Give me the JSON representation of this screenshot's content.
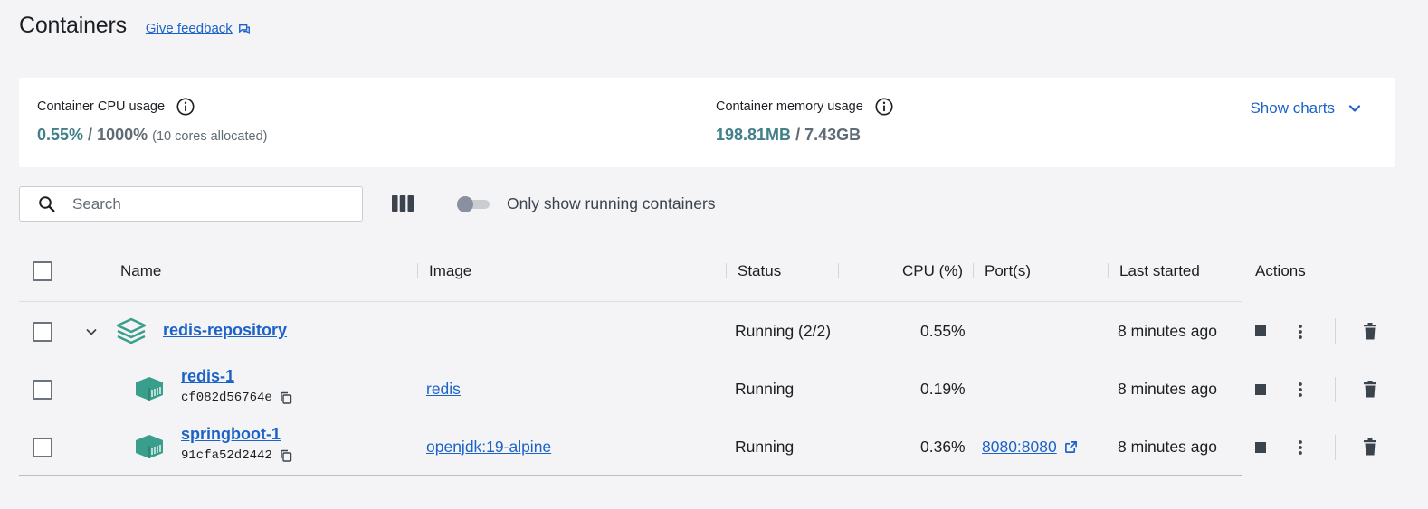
{
  "header": {
    "title": "Containers",
    "feedback_label": "Give feedback"
  },
  "usage": {
    "cpu_label": "Container CPU usage",
    "cpu_used": "0.55%",
    "cpu_sep": " / ",
    "cpu_total": "1000%",
    "cpu_cores": "(10 cores allocated)",
    "mem_label": "Container memory usage",
    "mem_used": "198.81MB",
    "mem_sep": " / ",
    "mem_total": "7.43GB",
    "show_charts_label": "Show charts"
  },
  "toolbar": {
    "search_placeholder": "Search",
    "running_toggle_label": "Only show running containers",
    "running_toggle_on": false
  },
  "table": {
    "columns": [
      "Name",
      "Image",
      "Status",
      "CPU (%)",
      "Port(s)",
      "Last started",
      "Actions"
    ],
    "rows": [
      {
        "name": "redis-repository",
        "id": "",
        "image": "",
        "status": "Running (2/2)",
        "cpu": "0.55%",
        "ports": "",
        "last_started": "8 minutes ago"
      },
      {
        "name": "redis-1",
        "id": "cf082d56764e",
        "image": "redis",
        "status": "Running",
        "cpu": "0.19%",
        "ports": "",
        "last_started": "8 minutes ago"
      },
      {
        "name": "springboot-1",
        "id": "91cfa52d2442",
        "image": "openjdk:19-alpine",
        "status": "Running",
        "cpu": "0.36%",
        "ports": "8080:8080",
        "last_started": "8 minutes ago"
      }
    ]
  },
  "colors": {
    "accent": "#1c63c8",
    "usage_green": "#42808a",
    "container_teal": "#3a9e8c"
  },
  "icons": [
    "feedback-icon",
    "info-icon",
    "chevron-down-icon",
    "search-icon",
    "columns-icon",
    "stack-icon",
    "container-icon",
    "copy-icon",
    "external-link-icon",
    "stop-icon",
    "more-icon",
    "trash-icon"
  ]
}
